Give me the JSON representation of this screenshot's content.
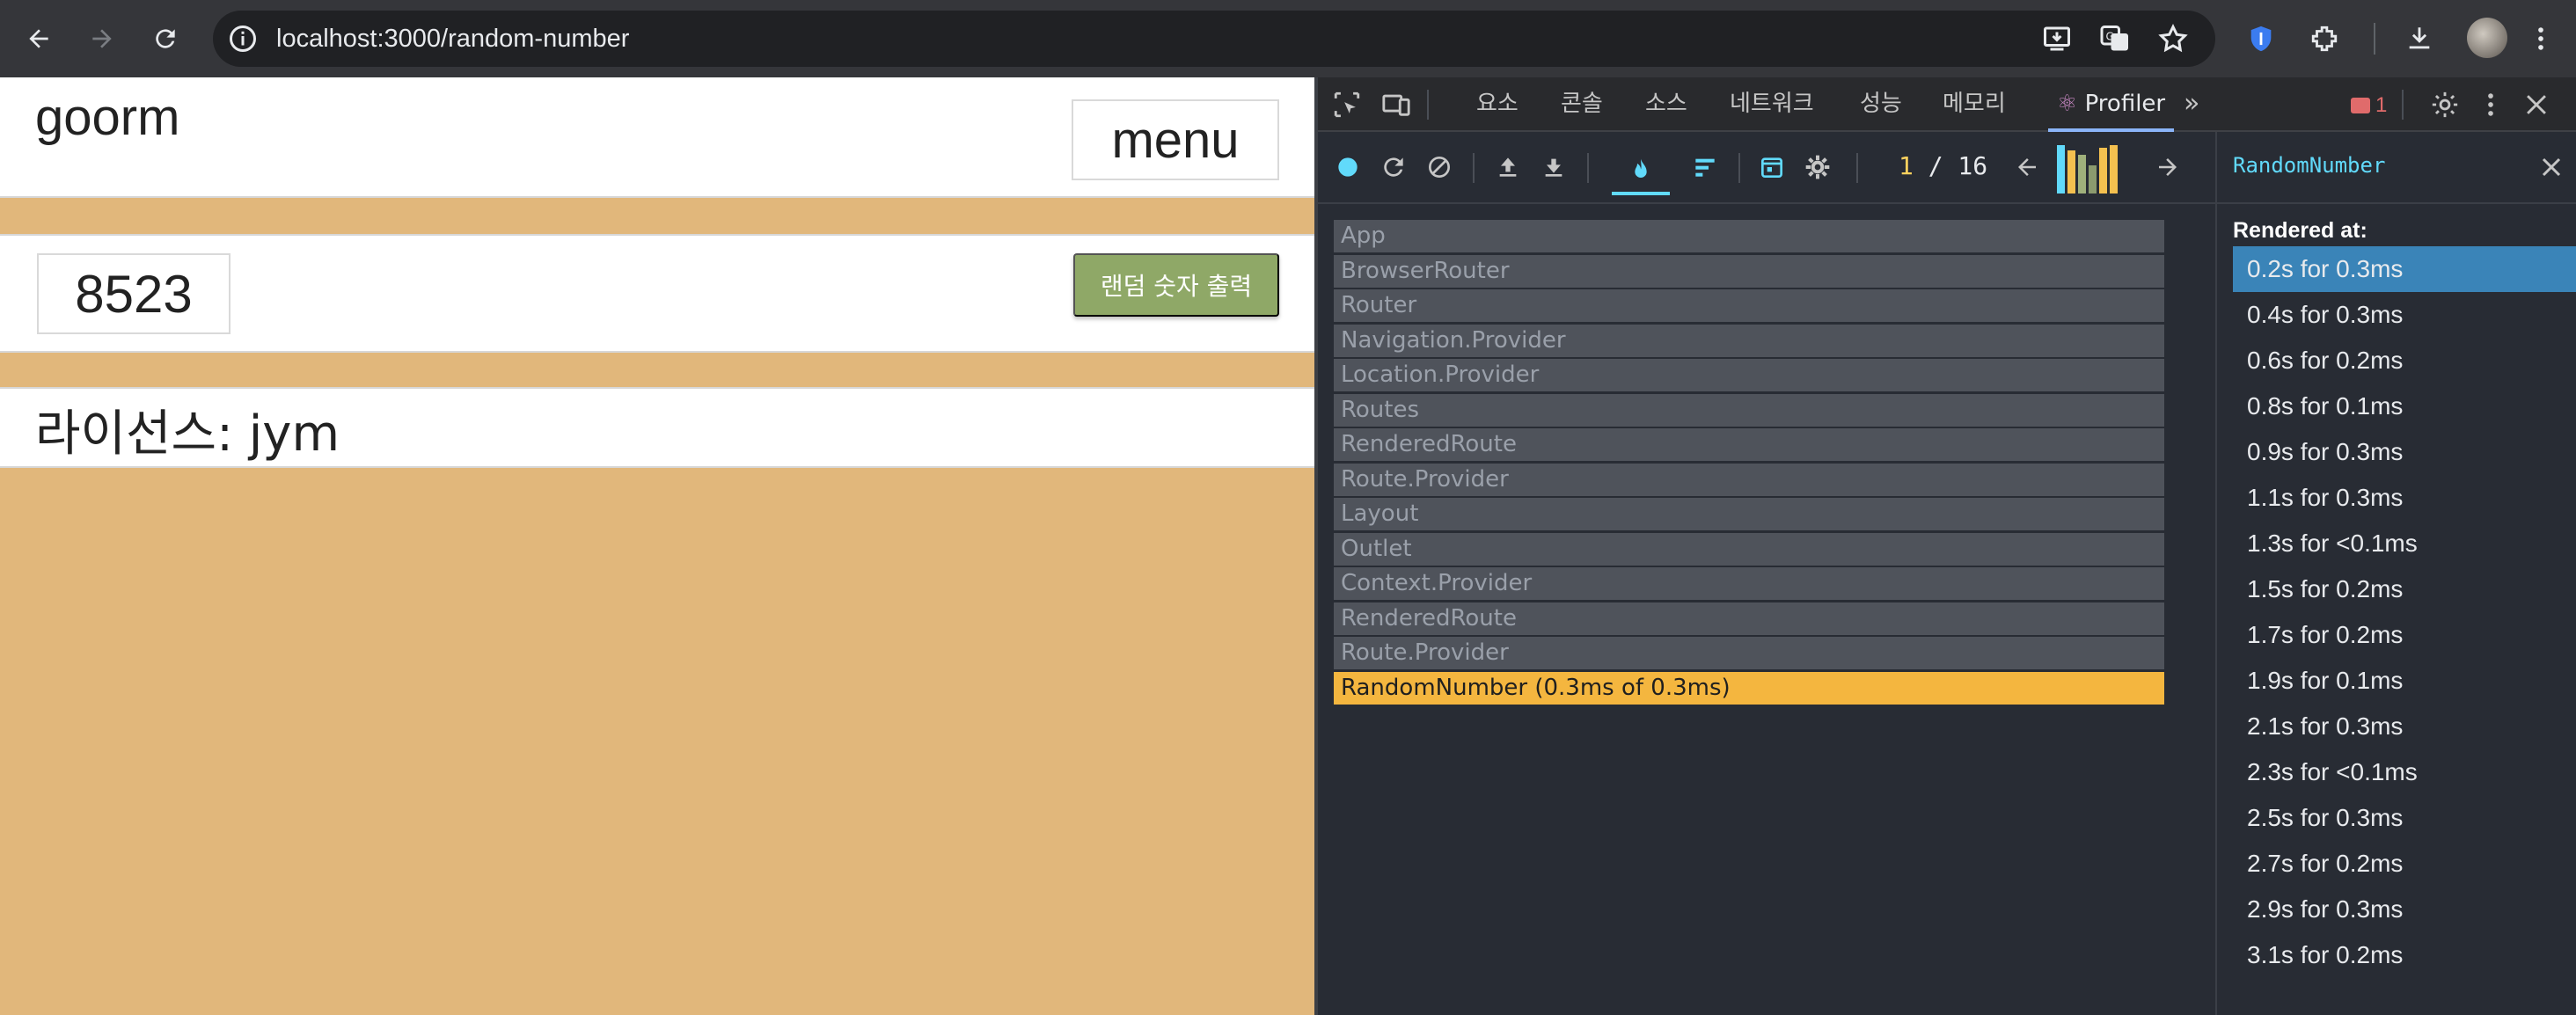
{
  "browser": {
    "url": "localhost:3000/random-number"
  },
  "page": {
    "brand": "goorm",
    "menu_label": "menu",
    "random_value": "8523",
    "random_button_label": "랜덤 숫자 출력",
    "license_text": "라이선스: jym"
  },
  "devtools": {
    "tabs": [
      "요소",
      "콘솔",
      "소스",
      "네트워크",
      "성능",
      "메모리",
      "Profiler"
    ],
    "active_tab": "Profiler",
    "error_count": "1",
    "commit_current": "1",
    "commit_total": "/ 16",
    "tree": [
      "App",
      "BrowserRouter",
      "Router",
      "Navigation.Provider",
      "Location.Provider",
      "Routes",
      "RenderedRoute",
      "Route.Provider",
      "Layout",
      "Outlet",
      "Context.Provider",
      "RenderedRoute",
      "Route.Provider",
      "RandomNumber (0.3ms of 0.3ms)"
    ],
    "selected_component": "RandomNumber",
    "rendered_at_label": "Rendered at:",
    "rendered_at": [
      "0.2s for 0.3ms",
      "0.4s for 0.3ms",
      "0.6s for 0.2ms",
      "0.8s for 0.1ms",
      "0.9s for 0.3ms",
      "1.1s for 0.3ms",
      "1.3s for <0.1ms",
      "1.5s for 0.2ms",
      "1.7s for 0.2ms",
      "1.9s for 0.1ms",
      "2.1s for 0.3ms",
      "2.3s for <0.1ms",
      "2.5s for 0.3ms",
      "2.7s for 0.2ms",
      "2.9s for 0.3ms",
      "3.1s for 0.2ms"
    ],
    "commit_bars": [
      0.95,
      0.85,
      0.75,
      0.55,
      0.9,
      0.95
    ],
    "colors": {
      "page_bg": "#e1b77b",
      "button_green": "#8fa867",
      "selected_row": "#f4b63f",
      "selected_render": "#3a84b8",
      "react_blue": "#61dafb"
    }
  }
}
